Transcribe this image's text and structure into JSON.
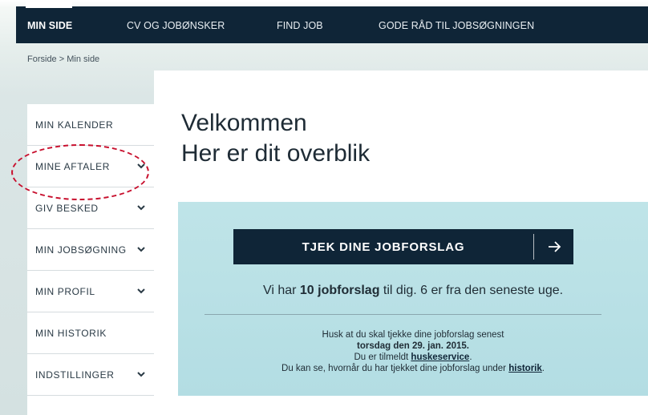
{
  "nav": {
    "items": [
      {
        "label": "MIN SIDE",
        "active": true
      },
      {
        "label": "CV OG JOBØNSKER",
        "active": false
      },
      {
        "label": "FIND JOB",
        "active": false
      },
      {
        "label": "GODE RÅD TIL JOBSØGNINGEN",
        "active": false
      }
    ]
  },
  "breadcrumb": "Forside > Min side",
  "sidebar": {
    "items": [
      {
        "label": "MIN KALENDER",
        "icon": "none"
      },
      {
        "label": "MINE AFTALER",
        "icon": "chevron-down-icon"
      },
      {
        "label": "GIV BESKED",
        "icon": "chevron-down-icon"
      },
      {
        "label": "MIN JOBSØGNING",
        "icon": "chevron-down-icon"
      },
      {
        "label": "MIN PROFIL",
        "icon": "chevron-down-icon"
      },
      {
        "label": "MIN HISTORIK",
        "icon": "none"
      },
      {
        "label": "INDSTILLINGER",
        "icon": "chevron-down-icon"
      }
    ]
  },
  "main": {
    "title_line1": "Velkommen",
    "title_line2": "Her er dit overblik",
    "cta_label": "TJEK DINE JOBFORSLAG",
    "cta_icon": "arrow-right-icon",
    "summary_pre": "Vi har ",
    "summary_bold": "10 jobforslag",
    "summary_post": " til dig. 6 er fra den seneste uge.",
    "reminder_line1": "Husk at du skal tjekke dine jobforslag senest",
    "reminder_date": "torsdag den 29. jan. 2015.",
    "reminder_line3_pre": "Du er tilmeldt ",
    "reminder_line3_link": "huskeservice",
    "reminder_line3_post": ".",
    "reminder_line4_pre": "Du kan se, hvornår du har tjekket dine jobforslag under ",
    "reminder_line4_link": "historik",
    "reminder_line4_post": "."
  },
  "colors": {
    "nav_bg": "#0f2537",
    "card_bg": "#b3dde3",
    "highlight_ellipse": "#c8102e"
  }
}
